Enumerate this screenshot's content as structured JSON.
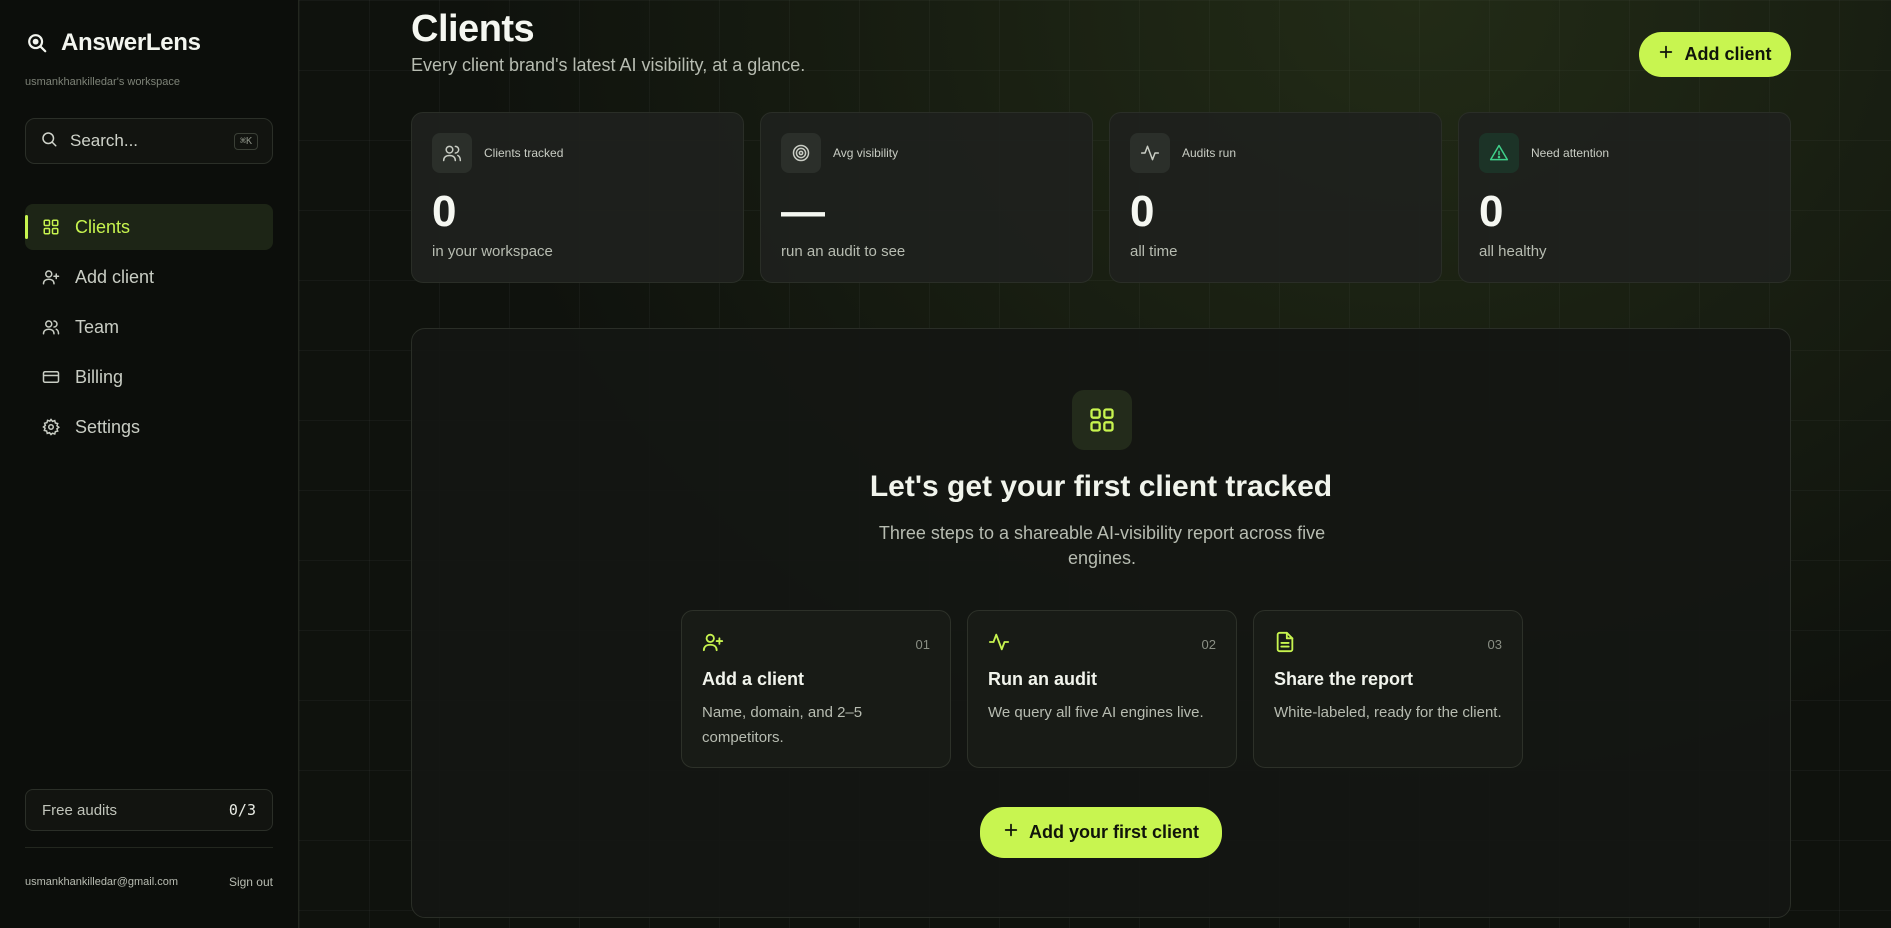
{
  "brand": {
    "name": "AnswerLens",
    "workspace": "usmankhankilledar's workspace"
  },
  "search": {
    "placeholder": "Search...",
    "shortcut": "⌘K"
  },
  "nav": [
    {
      "label": "Clients",
      "icon": "grid-icon",
      "active": true
    },
    {
      "label": "Add client",
      "icon": "user-plus-icon",
      "active": false
    },
    {
      "label": "Team",
      "icon": "users-icon",
      "active": false
    },
    {
      "label": "Billing",
      "icon": "credit-card-icon",
      "active": false
    },
    {
      "label": "Settings",
      "icon": "gear-icon",
      "active": false
    }
  ],
  "free_audits": {
    "label": "Free audits",
    "value": "0/3"
  },
  "account": {
    "email": "usmankhankilledar@gmail.com",
    "sign_out": "Sign out"
  },
  "header": {
    "title": "Clients",
    "subtitle": "Every client brand's latest AI visibility, at a glance.",
    "add_button": "Add client"
  },
  "stats": [
    {
      "label": "Clients tracked",
      "value": "0",
      "note": "in your workspace",
      "icon": "users-icon"
    },
    {
      "label": "Avg visibility",
      "value": "—",
      "note": "run an audit to see",
      "icon": "target-icon"
    },
    {
      "label": "Audits run",
      "value": "0",
      "note": "all time",
      "icon": "activity-icon"
    },
    {
      "label": "Need attention",
      "value": "0",
      "note": "all healthy",
      "icon": "alert-triangle-icon"
    }
  ],
  "empty_state": {
    "title": "Let's get your first client tracked",
    "subtitle": "Three steps to a shareable AI-visibility report across five engines.",
    "steps": [
      {
        "num": "01",
        "title": "Add a client",
        "desc": "Name, domain, and 2–5 competitors.",
        "icon": "user-plus-icon"
      },
      {
        "num": "02",
        "title": "Run an audit",
        "desc": "We query all five AI engines live.",
        "icon": "activity-icon"
      },
      {
        "num": "03",
        "title": "Share the report",
        "desc": "White-labeled, ready for the client.",
        "icon": "file-text-icon"
      }
    ],
    "cta": "Add your first client"
  },
  "colors": {
    "accent": "#c8f550",
    "background": "#0f120d",
    "card": "#1e211d",
    "warn": "#3fd08a"
  }
}
